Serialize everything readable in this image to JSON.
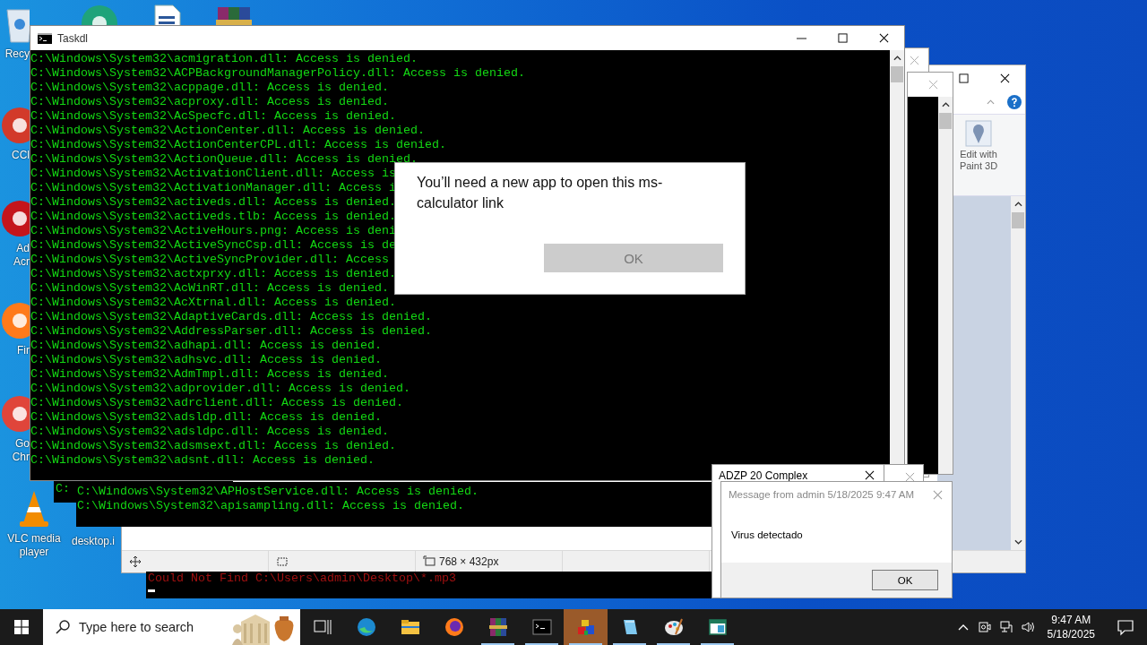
{
  "desktop_icons": [
    {
      "kind": "recycle-bin",
      "lines": [
        "Recy"
      ]
    },
    {
      "kind": "ccleaner",
      "lines": [
        "CCl"
      ]
    },
    {
      "kind": "acrobat",
      "lines": [
        "Ad",
        "Acr"
      ]
    },
    {
      "kind": "firefox",
      "lines": [
        "Fir"
      ]
    },
    {
      "kind": "chrome",
      "lines": [
        "Go",
        "Chr"
      ]
    },
    {
      "kind": "vlc",
      "lines": [
        "VLC media",
        "player"
      ]
    },
    {
      "kind": "file",
      "lines": [
        "desktop.i"
      ]
    },
    {
      "kind": "edge"
    },
    {
      "kind": "document"
    },
    {
      "kind": "winrar"
    }
  ],
  "paint": {
    "ribbon_button": "Edit with Paint 3D",
    "image_size": "768 × 432px"
  },
  "console_back_left": {
    "lines": [
      "C:"
    ]
  },
  "console_back_middle": {
    "lines": [
      "C:\\Windows\\System32\\APHostService.dll: Access is denied.",
      "C:\\Windows\\System32\\apisampling.dll: Access is denied."
    ]
  },
  "console_back_bottom": {
    "errors": [
      "Could Not Find C:\\Users\\admin\\Desktop\\*.mp3"
    ]
  },
  "taskdl": {
    "title": "Taskdl",
    "lines": [
      "C:\\Windows\\System32\\acmigration.dll: Access is denied.",
      "C:\\Windows\\System32\\ACPBackgroundManagerPolicy.dll: Access is denied.",
      "C:\\Windows\\System32\\acppage.dll: Access is denied.",
      "C:\\Windows\\System32\\acproxy.dll: Access is denied.",
      "C:\\Windows\\System32\\AcSpecfc.dll: Access is denied.",
      "C:\\Windows\\System32\\ActionCenter.dll: Access is denied.",
      "C:\\Windows\\System32\\ActionCenterCPL.dll: Access is denied.",
      "C:\\Windows\\System32\\ActionQueue.dll: Access is denied.",
      "C:\\Windows\\System32\\ActivationClient.dll: Access is",
      "C:\\Windows\\System32\\ActivationManager.dll: Access i",
      "C:\\Windows\\System32\\activeds.dll: Access is denied.",
      "C:\\Windows\\System32\\activeds.tlb: Access is denied.",
      "C:\\Windows\\System32\\ActiveHours.png: Access is deni",
      "C:\\Windows\\System32\\ActiveSyncCsp.dll: Access is de",
      "C:\\Windows\\System32\\ActiveSyncProvider.dll: Access",
      "C:\\Windows\\System32\\actxprxy.dll: Access is denied.",
      "C:\\Windows\\System32\\AcWinRT.dll: Access is denied.",
      "C:\\Windows\\System32\\AcXtrnal.dll: Access is denied.",
      "C:\\Windows\\System32\\AdaptiveCards.dll: Access is denied.",
      "C:\\Windows\\System32\\AddressParser.dll: Access is denied.",
      "C:\\Windows\\System32\\adhapi.dll: Access is denied.",
      "C:\\Windows\\System32\\adhsvc.dll: Access is denied.",
      "C:\\Windows\\System32\\AdmTmpl.dll: Access is denied.",
      "C:\\Windows\\System32\\adprovider.dll: Access is denied.",
      "C:\\Windows\\System32\\adrclient.dll: Access is denied.",
      "C:\\Windows\\System32\\adsldp.dll: Access is denied.",
      "C:\\Windows\\System32\\adsldpc.dll: Access is denied.",
      "C:\\Windows\\System32\\adsmsext.dll: Access is denied.",
      "C:\\Windows\\System32\\adsnt.dll: Access is denied."
    ]
  },
  "app_dialog": {
    "message": "You’ll need a new app to open this ms-calculator link",
    "button": {
      "label": "OK",
      "disabled": true
    }
  },
  "adzp_window": {
    "title": "ADZP 20 Complex"
  },
  "message_box": {
    "title": "Message from admin 5/18/2025 9:47 AM",
    "text": "Virus detectado",
    "button": "OK"
  },
  "taskbar": {
    "search_placeholder": "Type here to search",
    "apps": [
      {
        "kind": "task-view",
        "running": false,
        "selected": false
      },
      {
        "kind": "edge",
        "running": false,
        "selected": false
      },
      {
        "kind": "folder",
        "running": false,
        "selected": false
      },
      {
        "kind": "firefox",
        "running": false,
        "selected": false
      },
      {
        "kind": "winrar",
        "running": true,
        "selected": false
      },
      {
        "kind": "terminal",
        "running": true,
        "selected": false
      },
      {
        "kind": "blocks",
        "running": true,
        "selected": true
      },
      {
        "kind": "notepad",
        "running": true,
        "selected": false
      },
      {
        "kind": "paint",
        "running": true,
        "selected": false
      },
      {
        "kind": "window",
        "running": true,
        "selected": false
      }
    ],
    "time": "9:47 AM",
    "date": "5/18/2025"
  }
}
